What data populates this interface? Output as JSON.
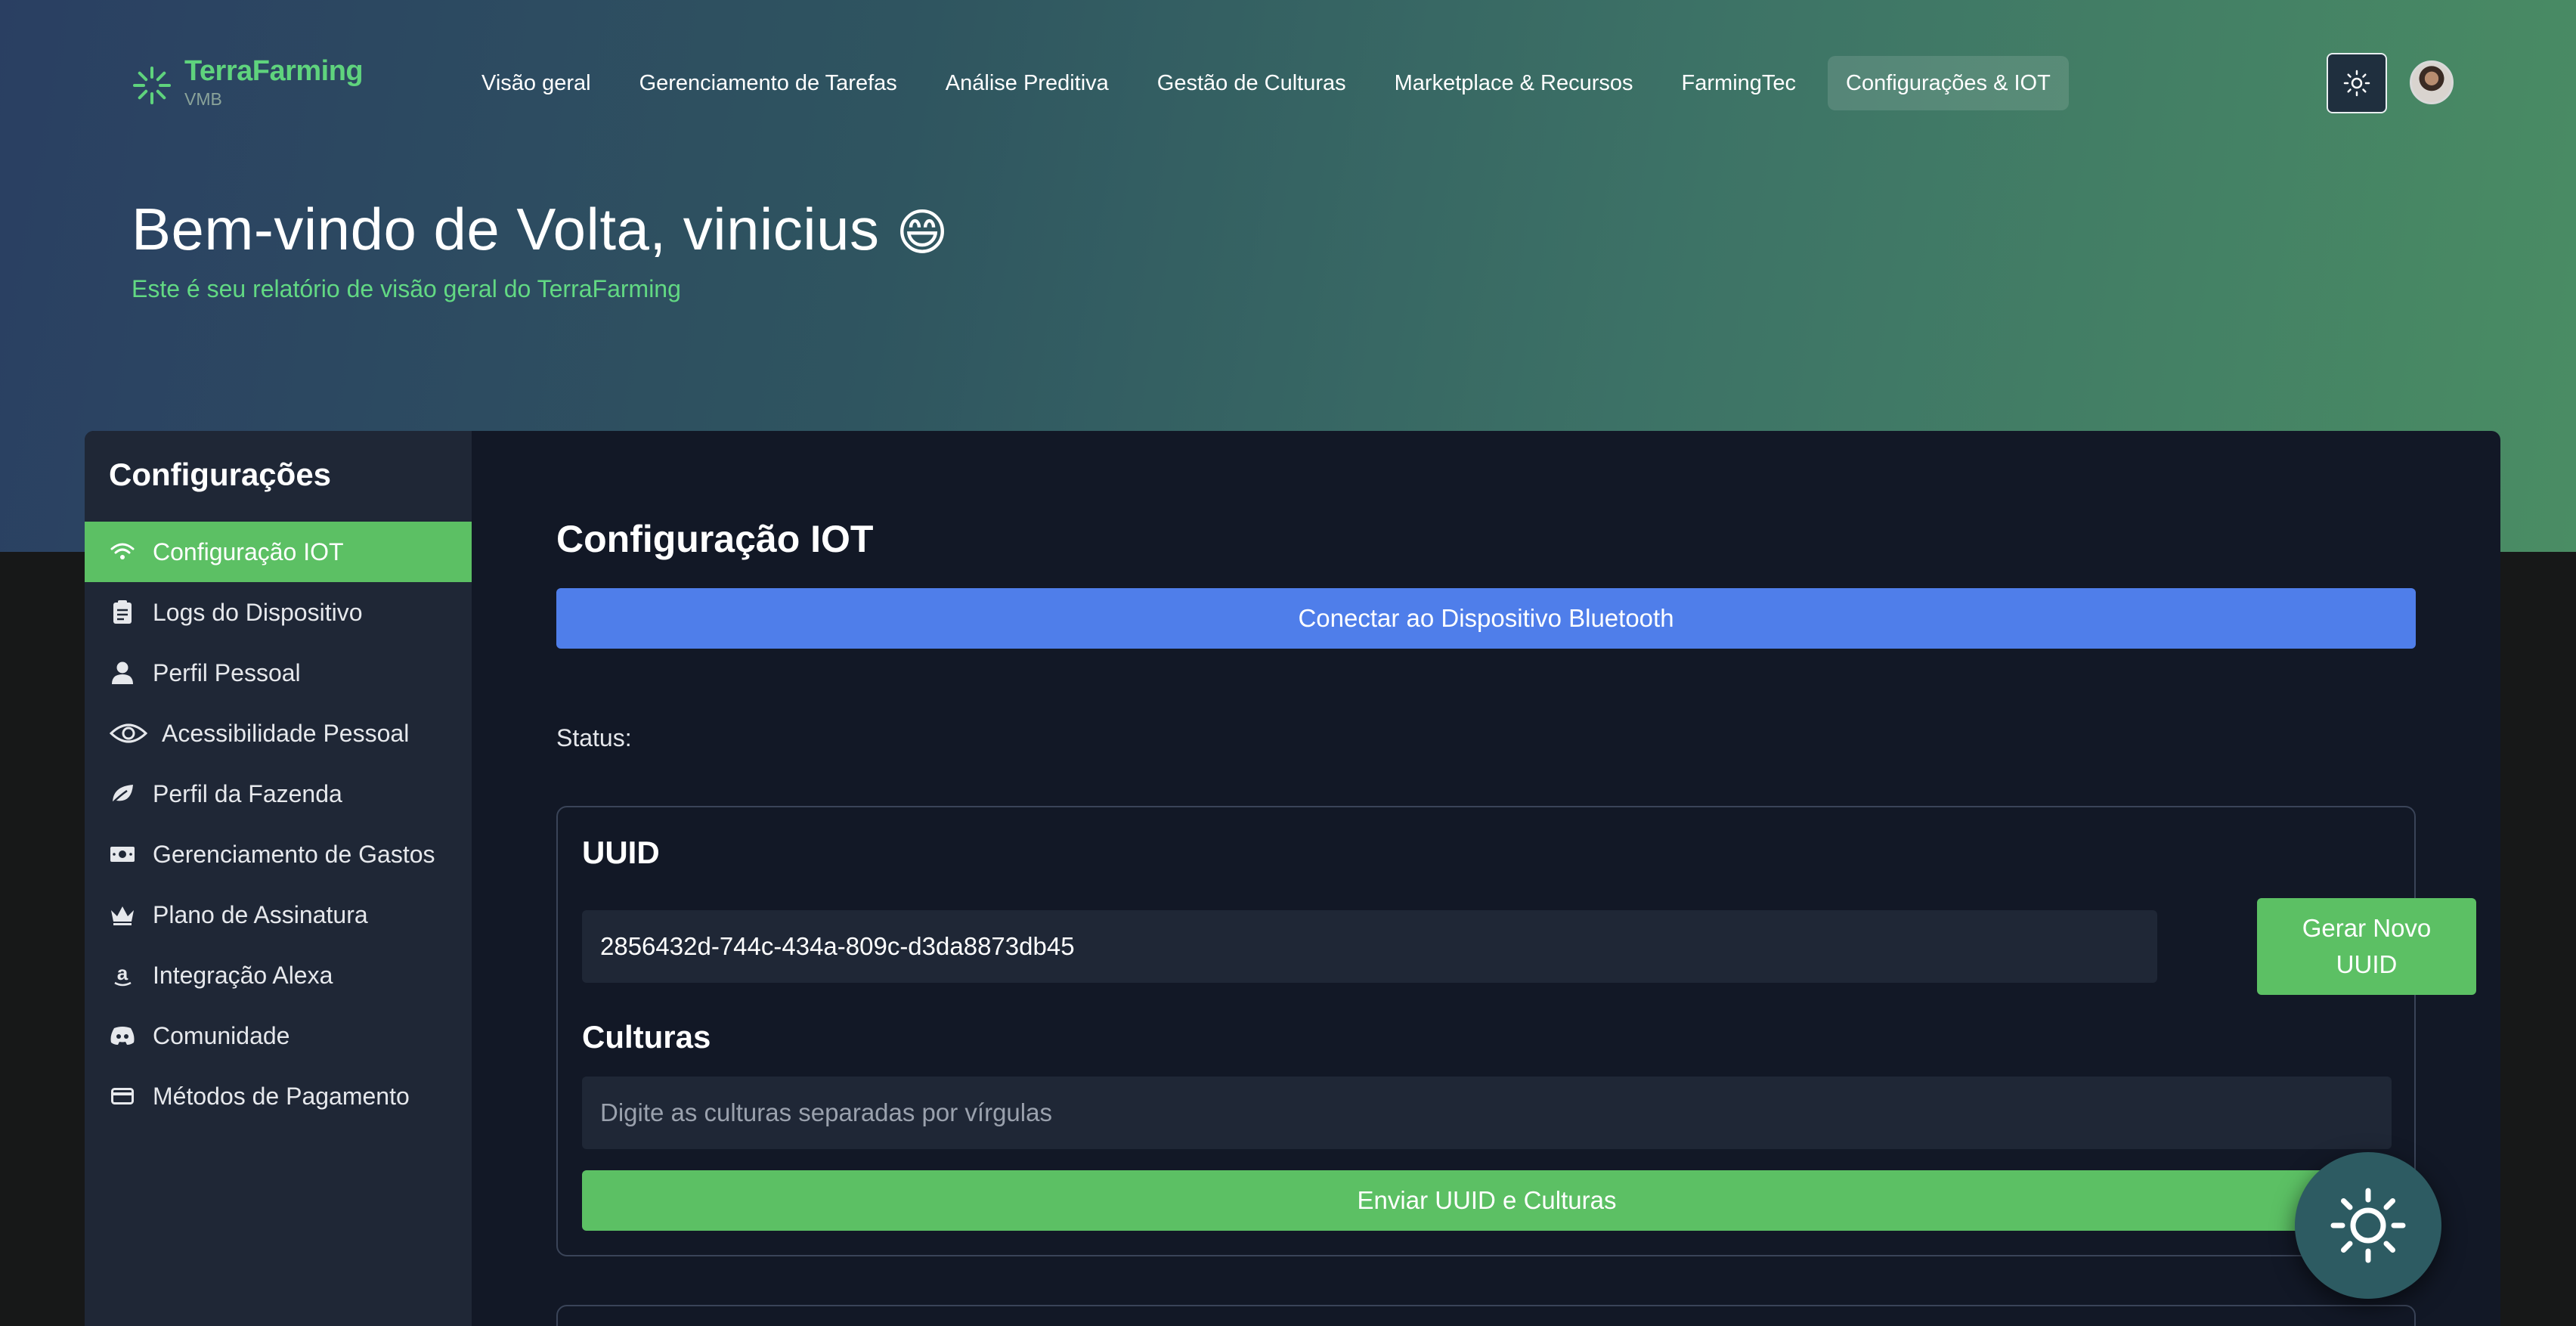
{
  "brand": {
    "name": "TerraFarming",
    "sub": "VMB"
  },
  "nav": {
    "items": [
      {
        "label": "Visão geral"
      },
      {
        "label": "Gerenciamento de Tarefas"
      },
      {
        "label": "Análise Preditiva"
      },
      {
        "label": "Gestão de Culturas"
      },
      {
        "label": "Marketplace & Recursos"
      },
      {
        "label": "FarmingTec"
      },
      {
        "label": "Configurações & IOT",
        "active": true
      }
    ],
    "theme_icon": "sun-icon",
    "avatar": "user-avatar"
  },
  "header": {
    "greeting": "Bem-vindo de Volta, vinicius",
    "emoji": "😄",
    "subtitle": "Este é seu relatório de visão geral do TerraFarming"
  },
  "sidebar": {
    "title": "Configurações",
    "items": [
      {
        "label": "Configuração IOT",
        "icon": "wifi-icon",
        "active": true
      },
      {
        "label": "Logs do Dispositivo",
        "icon": "clipboard-icon"
      },
      {
        "label": "Perfil Pessoal",
        "icon": "user-icon"
      },
      {
        "label": "Acessibilidade Pessoal",
        "icon": "eye-icon"
      },
      {
        "label": "Perfil da Fazenda",
        "icon": "leaf-icon"
      },
      {
        "label": "Gerenciamento de Gastos",
        "icon": "money-icon"
      },
      {
        "label": "Plano de Assinatura",
        "icon": "crown-icon"
      },
      {
        "label": "Integração Alexa",
        "icon": "amazon-icon"
      },
      {
        "label": "Comunidade",
        "icon": "discord-icon"
      },
      {
        "label": "Métodos de Pagamento",
        "icon": "credit-card-icon"
      }
    ]
  },
  "main": {
    "title": "Configuração IOT",
    "bluetooth_button": "Conectar ao Dispositivo Bluetooth",
    "status_label": "Status:",
    "uuid_label": "UUID",
    "uuid_value": "2856432d-744c-434a-809c-d3da8873db45",
    "generate_button": "Gerar Novo UUID",
    "cultures_label": "Culturas",
    "cultures_placeholder": "Digite as culturas separadas por vírgulas",
    "send_button": "Enviar UUID e Culturas"
  },
  "fab": {
    "icon": "sun-icon"
  },
  "colors": {
    "accent_green": "#5cc064",
    "accent_blue": "#4f7eea",
    "panel_bg": "#121826",
    "sidebar_bg": "#1f2736"
  }
}
